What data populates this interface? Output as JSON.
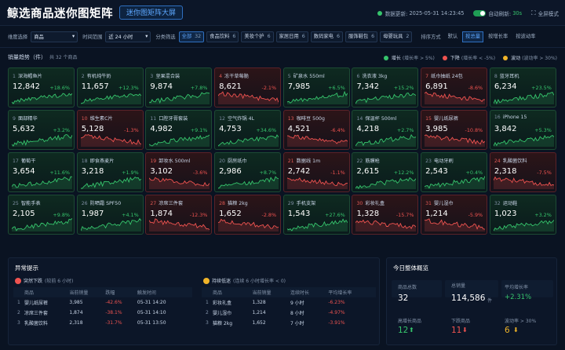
{
  "header": {
    "title": "鲸选商品迷你图矩阵",
    "big_tab": "迷你图矩阵大屏",
    "status_label": "数据更新:",
    "status_time": "2025-05-31 14:23:45",
    "refresh_label": "自动刷新:",
    "refresh_value": "30s",
    "fullscreen": "全屏模式"
  },
  "filters": {
    "dim_label": "维度选择",
    "dim_value": "商品",
    "time_label": "时间范围",
    "time_value": "近 24 小时",
    "cat_label": "分类筛选",
    "cats": [
      {
        "label": "全部",
        "count": "32",
        "active": true
      },
      {
        "label": "食品饮料",
        "count": "6"
      },
      {
        "label": "美妆个护",
        "count": "6"
      },
      {
        "label": "家居日用",
        "count": "6"
      },
      {
        "label": "数码家电",
        "count": "6"
      },
      {
        "label": "服饰鞋包",
        "count": "6"
      },
      {
        "label": "母婴玩具",
        "count": "2"
      }
    ],
    "sort_label": "排序方式",
    "sorts": [
      "默认",
      "按总量",
      "按增长率",
      "按波动率"
    ],
    "sort_active": 1
  },
  "section": {
    "title": "销量趋势（件）",
    "sub": "共 32 个商品",
    "legend": [
      {
        "name": "增长",
        "desc": "(增长率 > 5%)",
        "color": "#36c46c"
      },
      {
        "name": "下降",
        "desc": "(增长率 < -5%)",
        "color": "#ef5350"
      },
      {
        "name": "波动",
        "desc": "(波动率 > 30%)",
        "color": "#f0b429"
      }
    ]
  },
  "cards": [
    {
      "n": "1",
      "name": "深海鳕鱼片",
      "value": "12,842",
      "pct": "+18.6%",
      "dir": "up"
    },
    {
      "n": "2",
      "name": "有机纯牛奶",
      "value": "11,657",
      "pct": "+12.3%",
      "dir": "up"
    },
    {
      "n": "3",
      "name": "坚果混合装",
      "value": "9,874",
      "pct": "+7.8%",
      "dir": "up"
    },
    {
      "n": "4",
      "name": "冻干草莓脆",
      "value": "8,621",
      "pct": "-2.1%",
      "dir": "down"
    },
    {
      "n": "5",
      "name": "矿泉水 550ml",
      "value": "7,985",
      "pct": "+6.5%",
      "dir": "up"
    },
    {
      "n": "6",
      "name": "洗衣液 3kg",
      "value": "7,342",
      "pct": "+15.2%",
      "dir": "up"
    },
    {
      "n": "7",
      "name": "纸巾抽纸 24包",
      "value": "6,891",
      "pct": "-8.6%",
      "dir": "down"
    },
    {
      "n": "8",
      "name": "蓝牙耳机",
      "value": "6,234",
      "pct": "+23.5%",
      "dir": "up"
    },
    {
      "n": "9",
      "name": "面部精华",
      "value": "5,632",
      "pct": "+3.2%",
      "dir": "up"
    },
    {
      "n": "10",
      "name": "维生素C片",
      "value": "5,128",
      "pct": "-1.3%",
      "dir": "down"
    },
    {
      "n": "11",
      "name": "口腔牙膏套装",
      "value": "4,982",
      "pct": "+9.1%",
      "dir": "up"
    },
    {
      "n": "12",
      "name": "空气炸锅 4L",
      "value": "4,753",
      "pct": "+34.6%",
      "dir": "up"
    },
    {
      "n": "13",
      "name": "咖啡豆 500g",
      "value": "4,521",
      "pct": "-6.4%",
      "dir": "down"
    },
    {
      "n": "14",
      "name": "保温杯 500ml",
      "value": "4,218",
      "pct": "+2.7%",
      "dir": "up"
    },
    {
      "n": "15",
      "name": "婴儿纸尿裤",
      "value": "3,985",
      "pct": "-10.8%",
      "dir": "down"
    },
    {
      "n": "16",
      "name": "iPhone 15",
      "value": "3,842",
      "pct": "+5.3%",
      "dir": "up"
    },
    {
      "n": "17",
      "name": "葡萄干",
      "value": "3,654",
      "pct": "+11.6%",
      "dir": "up"
    },
    {
      "n": "18",
      "name": "即食燕麦片",
      "value": "3,218",
      "pct": "+1.9%",
      "dir": "up"
    },
    {
      "n": "19",
      "name": "卸妆水 500ml",
      "value": "3,102",
      "pct": "-3.6%",
      "dir": "down"
    },
    {
      "n": "20",
      "name": "厨房纸巾",
      "value": "2,986",
      "pct": "+8.7%",
      "dir": "up"
    },
    {
      "n": "21",
      "name": "数据线 1m",
      "value": "2,742",
      "pct": "-1.1%",
      "dir": "down"
    },
    {
      "n": "22",
      "name": "筋膜枪",
      "value": "2,615",
      "pct": "+12.2%",
      "dir": "up"
    },
    {
      "n": "23",
      "name": "电动牙刷",
      "value": "2,543",
      "pct": "+0.4%",
      "dir": "up"
    },
    {
      "n": "24",
      "name": "乳酸菌饮料",
      "value": "2,318",
      "pct": "-7.5%",
      "dir": "down"
    },
    {
      "n": "25",
      "name": "智能手表",
      "value": "2,105",
      "pct": "+9.8%",
      "dir": "up"
    },
    {
      "n": "26",
      "name": "防晒霜 SPF50",
      "value": "1,987",
      "pct": "+4.1%",
      "dir": "up"
    },
    {
      "n": "27",
      "name": "凉席三件套",
      "value": "1,874",
      "pct": "-12.3%",
      "dir": "down"
    },
    {
      "n": "28",
      "name": "猫粮 2kg",
      "value": "1,652",
      "pct": "-2.8%",
      "dir": "down"
    },
    {
      "n": "29",
      "name": "手机支架",
      "value": "1,543",
      "pct": "+27.6%",
      "dir": "up"
    },
    {
      "n": "30",
      "name": "彩妆礼盒",
      "value": "1,328",
      "pct": "-15.7%",
      "dir": "down"
    },
    {
      "n": "31",
      "name": "婴儿湿巾",
      "value": "1,214",
      "pct": "-5.9%",
      "dir": "down"
    },
    {
      "n": "32",
      "name": "运动鞋",
      "value": "1,023",
      "pct": "+3.2%",
      "dir": "up"
    }
  ],
  "anomaly": {
    "title": "异常提示",
    "drop": {
      "label": "突然下跌",
      "note": "(较前 6 小时)",
      "headers": [
        "商品",
        "当前销量",
        "跌幅",
        "触发时间"
      ],
      "rows": [
        [
          "1",
          "婴儿纸尿裤",
          "3,985",
          "-42.6%",
          "05-31 14:20"
        ],
        [
          "2",
          "凉席三件套",
          "1,874",
          "-38.1%",
          "05-31 14:10"
        ],
        [
          "3",
          "乳酸菌饮料",
          "2,318",
          "-31.7%",
          "05-31 13:50"
        ]
      ]
    },
    "slow": {
      "label": "持续低迷",
      "note": "(连续 6 小时增长率 < 0)",
      "headers": [
        "商品",
        "当前销量",
        "连续时长",
        "平均增长率"
      ],
      "rows": [
        [
          "1",
          "彩妆礼盒",
          "1,328",
          "9 小时",
          "-6.23%"
        ],
        [
          "2",
          "婴儿湿巾",
          "1,214",
          "8 小时",
          "-4.97%"
        ],
        [
          "3",
          "猫粮 2kg",
          "1,652",
          "7 小时",
          "-3.91%"
        ]
      ]
    }
  },
  "summary": {
    "title": "今日整体概览",
    "total_label": "商品总数",
    "total": "32",
    "sales_label": "总销量",
    "sales": "114,586",
    "sales_unit": "件",
    "avg_label": "平均增长率",
    "avg": "+2.31%",
    "high_label": "高增长商品",
    "high": "12",
    "low_label": "下跌商品",
    "low": "11",
    "vol_label": "波动率 > 30%",
    "vol": "6"
  }
}
